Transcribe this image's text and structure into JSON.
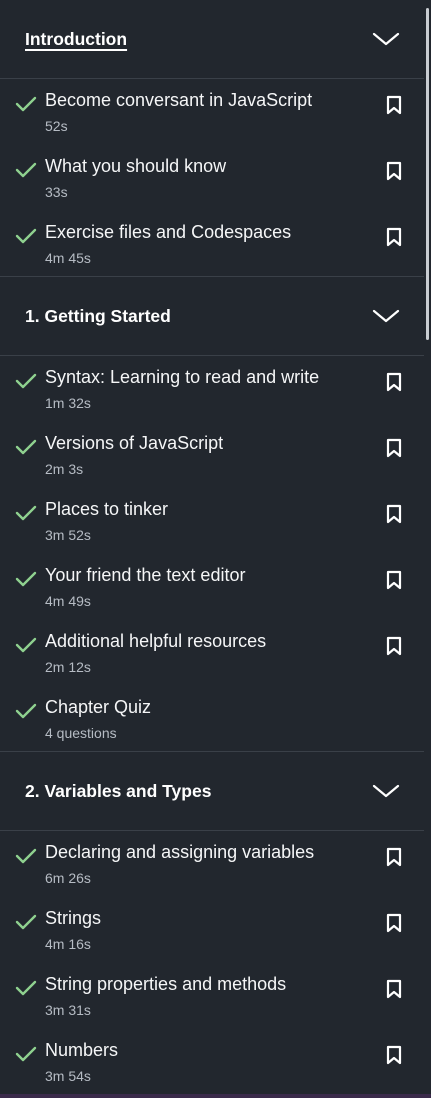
{
  "sections": [
    {
      "title": "Introduction",
      "items": [
        {
          "title": "Become conversant in JavaScript",
          "meta": "52s",
          "bookmark": true
        },
        {
          "title": "What you should know",
          "meta": "33s",
          "bookmark": true
        },
        {
          "title": "Exercise files and Codespaces",
          "meta": "4m 45s",
          "bookmark": true
        }
      ]
    },
    {
      "title": "1. Getting Started",
      "items": [
        {
          "title": "Syntax: Learning to read and write",
          "meta": "1m 32s",
          "bookmark": true
        },
        {
          "title": "Versions of JavaScript",
          "meta": "2m 3s",
          "bookmark": true
        },
        {
          "title": "Places to tinker",
          "meta": "3m 52s",
          "bookmark": true
        },
        {
          "title": "Your friend the text editor",
          "meta": "4m 49s",
          "bookmark": true
        },
        {
          "title": "Additional helpful resources",
          "meta": "2m 12s",
          "bookmark": true
        },
        {
          "title": "Chapter Quiz",
          "meta": "4 questions",
          "bookmark": false
        }
      ]
    },
    {
      "title": "2. Variables and Types",
      "items": [
        {
          "title": "Declaring and assigning variables",
          "meta": "6m 26s",
          "bookmark": true
        },
        {
          "title": "Strings",
          "meta": "4m 16s",
          "bookmark": true
        },
        {
          "title": "String properties and methods",
          "meta": "3m 31s",
          "bookmark": true
        },
        {
          "title": "Numbers",
          "meta": "3m 54s",
          "bookmark": true
        }
      ]
    }
  ],
  "icons": {
    "completed": "check-icon",
    "bookmark": "bookmark-icon",
    "collapse": "chevron-down-icon"
  },
  "colors": {
    "background": "#22272e",
    "check": "#8fd18f",
    "divider": "#3a4048"
  }
}
